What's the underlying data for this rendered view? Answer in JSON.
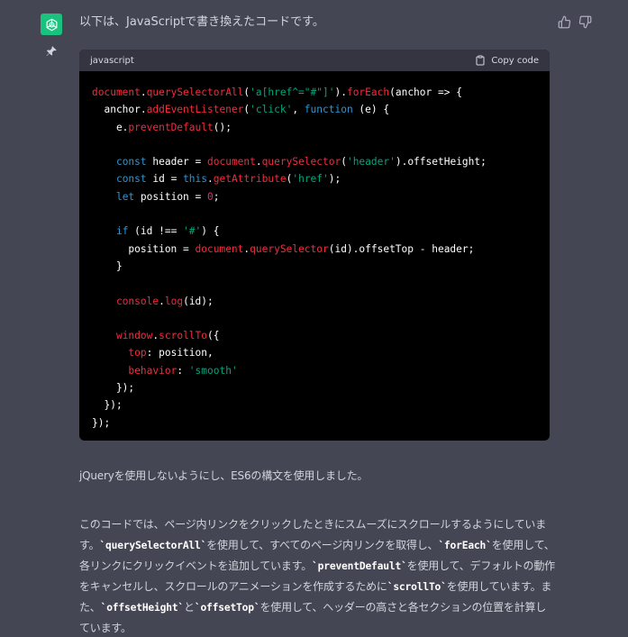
{
  "assistant": {
    "avatar_icon": "openai-logo-icon",
    "avatar_color": "#19c37d"
  },
  "message": {
    "intro": "以下は、JavaScriptで書き換えたコードです。",
    "code_block": {
      "language": "javascript",
      "copy_label": "Copy code",
      "lines": [
        [
          {
            "t": "document",
            "c": "fn"
          },
          {
            "t": ".",
            "c": "pl"
          },
          {
            "t": "querySelectorAll",
            "c": "fn"
          },
          {
            "t": "(",
            "c": "pl"
          },
          {
            "t": "'a[href^=\"#\"]'",
            "c": "st"
          },
          {
            "t": ").",
            "c": "pl"
          },
          {
            "t": "forEach",
            "c": "fn"
          },
          {
            "t": "(anchor => {",
            "c": "pl"
          }
        ],
        [
          {
            "t": "  anchor.",
            "c": "pl"
          },
          {
            "t": "addEventListener",
            "c": "fn"
          },
          {
            "t": "(",
            "c": "pl"
          },
          {
            "t": "'click'",
            "c": "st"
          },
          {
            "t": ", ",
            "c": "pl"
          },
          {
            "t": "function",
            "c": "kw"
          },
          {
            "t": " (e) {",
            "c": "pl"
          }
        ],
        [
          {
            "t": "    e.",
            "c": "pl"
          },
          {
            "t": "preventDefault",
            "c": "fn"
          },
          {
            "t": "();",
            "c": "pl"
          }
        ],
        [],
        [
          {
            "t": "    ",
            "c": "pl"
          },
          {
            "t": "const",
            "c": "kw"
          },
          {
            "t": " header = ",
            "c": "pl"
          },
          {
            "t": "document",
            "c": "fn"
          },
          {
            "t": ".",
            "c": "pl"
          },
          {
            "t": "querySelector",
            "c": "fn"
          },
          {
            "t": "(",
            "c": "pl"
          },
          {
            "t": "'header'",
            "c": "st"
          },
          {
            "t": ").offsetHeight;",
            "c": "pl"
          }
        ],
        [
          {
            "t": "    ",
            "c": "pl"
          },
          {
            "t": "const",
            "c": "kw"
          },
          {
            "t": " id = ",
            "c": "pl"
          },
          {
            "t": "this",
            "c": "kw"
          },
          {
            "t": ".",
            "c": "pl"
          },
          {
            "t": "getAttribute",
            "c": "fn"
          },
          {
            "t": "(",
            "c": "pl"
          },
          {
            "t": "'href'",
            "c": "st"
          },
          {
            "t": ");",
            "c": "pl"
          }
        ],
        [
          {
            "t": "    ",
            "c": "pl"
          },
          {
            "t": "let",
            "c": "kw"
          },
          {
            "t": " position = ",
            "c": "pl"
          },
          {
            "t": "0",
            "c": "nm"
          },
          {
            "t": ";",
            "c": "pl"
          }
        ],
        [],
        [
          {
            "t": "    ",
            "c": "pl"
          },
          {
            "t": "if",
            "c": "kw"
          },
          {
            "t": " (id !== ",
            "c": "pl"
          },
          {
            "t": "'#'",
            "c": "st"
          },
          {
            "t": ") {",
            "c": "pl"
          }
        ],
        [
          {
            "t": "      position = ",
            "c": "pl"
          },
          {
            "t": "document",
            "c": "fn"
          },
          {
            "t": ".",
            "c": "pl"
          },
          {
            "t": "querySelector",
            "c": "fn"
          },
          {
            "t": "(id).offsetTop - header;",
            "c": "pl"
          }
        ],
        [
          {
            "t": "    }",
            "c": "pl"
          }
        ],
        [],
        [
          {
            "t": "    ",
            "c": "pl"
          },
          {
            "t": "console",
            "c": "fn"
          },
          {
            "t": ".",
            "c": "pl"
          },
          {
            "t": "log",
            "c": "fn"
          },
          {
            "t": "(id);",
            "c": "pl"
          }
        ],
        [],
        [
          {
            "t": "    ",
            "c": "pl"
          },
          {
            "t": "window",
            "c": "fn"
          },
          {
            "t": ".",
            "c": "pl"
          },
          {
            "t": "scrollTo",
            "c": "fn"
          },
          {
            "t": "({",
            "c": "pl"
          }
        ],
        [
          {
            "t": "      ",
            "c": "pl"
          },
          {
            "t": "top",
            "c": "fn"
          },
          {
            "t": ": position,",
            "c": "pl"
          }
        ],
        [
          {
            "t": "      ",
            "c": "pl"
          },
          {
            "t": "behavior",
            "c": "fn"
          },
          {
            "t": ": ",
            "c": "pl"
          },
          {
            "t": "'smooth'",
            "c": "st"
          }
        ],
        [
          {
            "t": "    });",
            "c": "pl"
          }
        ],
        [
          {
            "t": "  });",
            "c": "pl"
          }
        ],
        [
          {
            "t": "});",
            "c": "pl"
          }
        ]
      ]
    },
    "paragraph1": "jQueryを使用しないようにし、ES6の構文を使用しました。",
    "paragraph2": [
      {
        "text": "このコードでは、ページ内リンクをクリックしたときにスムーズにスクロールするようにしています。",
        "code": false
      },
      {
        "text": "`querySelectorAll`",
        "code": true
      },
      {
        "text": "を使用して、すべてのページ内リンクを取得し、",
        "code": false
      },
      {
        "text": "`forEach`",
        "code": true
      },
      {
        "text": "を使用して、各リンクにクリックイベントを追加しています。",
        "code": false
      },
      {
        "text": "`preventDefault`",
        "code": true
      },
      {
        "text": "を使用して、デフォルトの動作をキャンセルし、スクロールのアニメーションを作成するために",
        "code": false
      },
      {
        "text": "`scrollTo`",
        "code": true
      },
      {
        "text": "を使用しています。また、",
        "code": false
      },
      {
        "text": "`offsetHeight`",
        "code": true
      },
      {
        "text": "と",
        "code": false
      },
      {
        "text": "`offsetTop`",
        "code": true
      },
      {
        "text": "を使用して、ヘッダーの高さと各セクションの位置を計算しています。",
        "code": false
      }
    ]
  },
  "actions": {
    "thumbs_up_icon": "thumbs-up-icon",
    "thumbs_down_icon": "thumbs-down-icon",
    "pin_icon": "pin-icon"
  }
}
